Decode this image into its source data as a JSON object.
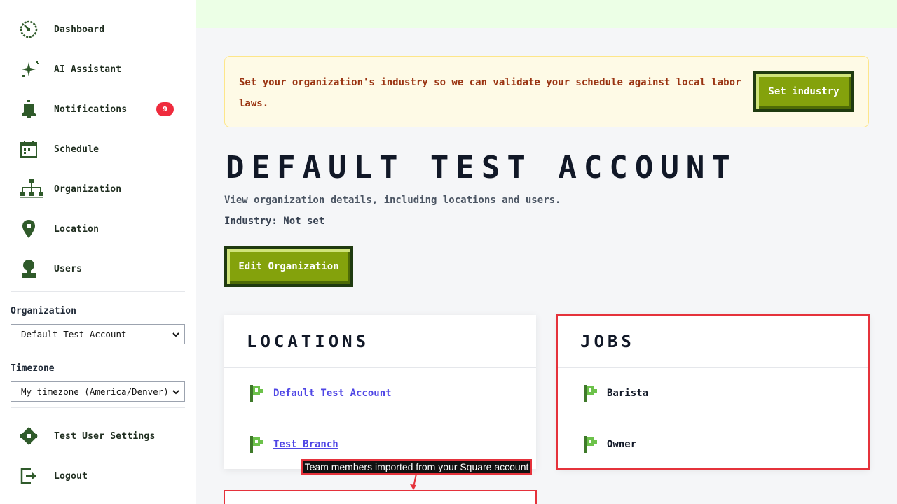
{
  "sidebar": {
    "nav": [
      {
        "label": "Dashboard",
        "icon": "dashboard-icon"
      },
      {
        "label": "AI Assistant",
        "icon": "sparkle-icon"
      },
      {
        "label": "Notifications",
        "icon": "bell-icon",
        "badge": "9"
      },
      {
        "label": "Schedule",
        "icon": "calendar-icon"
      },
      {
        "label": "Organization",
        "icon": "org-chart-icon"
      },
      {
        "label": "Location",
        "icon": "map-pin-icon"
      },
      {
        "label": "Users",
        "icon": "user-icon"
      }
    ],
    "organization_label": "Organization",
    "organization_value": "Default Test Account",
    "timezone_label": "Timezone",
    "timezone_value": "My timezone (America/Denver)",
    "footer": [
      {
        "label": "Test User Settings",
        "icon": "gear-icon"
      },
      {
        "label": "Logout",
        "icon": "logout-icon"
      }
    ]
  },
  "banner": {
    "text": "Set your organization's industry so we can validate your schedule against local labor laws.",
    "button": "Set industry"
  },
  "page": {
    "title": "DEFAULT TEST ACCOUNT",
    "subtitle": "View organization details, including locations and users.",
    "industry": "Industry: Not set",
    "edit_button": "Edit Organization"
  },
  "locations": {
    "title": "LOCATIONS",
    "items": [
      "Default Test Account",
      "Test Branch"
    ]
  },
  "jobs": {
    "title": "JOBS",
    "items": [
      "Barista",
      "Owner"
    ]
  },
  "tooltip": "Team members imported from your Square account",
  "colors": {
    "accent": "#84a20c",
    "sidebar_text": "#1f2d1f",
    "icon_green": "#2f5a2a",
    "badge": "#ef2b3d",
    "link": "#4f46e5",
    "highlight": "#e5323b"
  }
}
